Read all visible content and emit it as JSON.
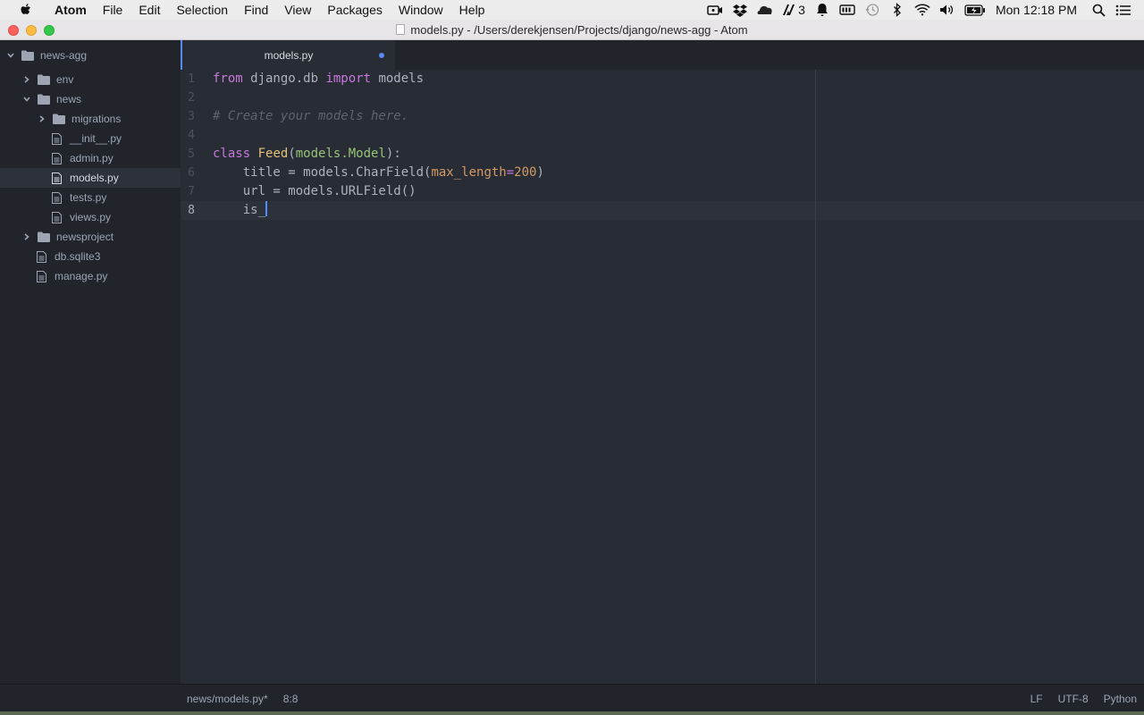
{
  "menubar": {
    "app_name": "Atom",
    "items": [
      "File",
      "Edit",
      "Selection",
      "Find",
      "View",
      "Packages",
      "Window",
      "Help"
    ],
    "adobe_count": "3",
    "clock": "Mon 12:18 PM"
  },
  "window": {
    "title": "models.py - /Users/derekjensen/Projects/django/news-agg - Atom"
  },
  "tree": {
    "items": [
      {
        "label": "news-agg",
        "type": "project",
        "expanded": true
      },
      {
        "label": "env",
        "type": "folder",
        "expanded": false
      },
      {
        "label": "news",
        "type": "folder",
        "expanded": true
      },
      {
        "label": "migrations",
        "type": "folder",
        "expanded": false
      },
      {
        "label": "__init__.py",
        "type": "file"
      },
      {
        "label": "admin.py",
        "type": "file"
      },
      {
        "label": "models.py",
        "type": "file",
        "selected": true
      },
      {
        "label": "tests.py",
        "type": "file"
      },
      {
        "label": "views.py",
        "type": "file"
      },
      {
        "label": "newsproject",
        "type": "folder",
        "expanded": false
      },
      {
        "label": "db.sqlite3",
        "type": "file"
      },
      {
        "label": "manage.py",
        "type": "file"
      }
    ]
  },
  "tab": {
    "title": "models.py",
    "modified": true
  },
  "editor": {
    "line_numbers": [
      "1",
      "2",
      "3",
      "4",
      "5",
      "6",
      "7",
      "8"
    ],
    "current_line": 8,
    "code": {
      "l1_from": "from",
      "l1_module": " django.db ",
      "l1_import": "import",
      "l1_name": " models",
      "l3_comment": "# Create your models here.",
      "l5_class": "class",
      "l5_name": "Feed",
      "l5_open": "(",
      "l5_base": "models.Model",
      "l5_close": "):",
      "l6_pre": "    title = models.CharField(",
      "l6_param": "max_length",
      "l6_eq": "=",
      "l6_num": "200",
      "l6_close": ")",
      "l7": "    url = models.URLField()",
      "l8": "    is_"
    }
  },
  "statusbar": {
    "file_path": "news/models.py*",
    "cursor_position": "8:8",
    "line_ending": "LF",
    "encoding": "UTF-8",
    "grammar": "Python"
  },
  "colors": {
    "accent": "#568af2",
    "editor_bg": "#282c34",
    "panel_bg": "#21252b",
    "keyword": "#c678dd",
    "class_name": "#e5c07b",
    "string_green": "#98c379",
    "number": "#d19a66",
    "comment": "#5c6370"
  }
}
